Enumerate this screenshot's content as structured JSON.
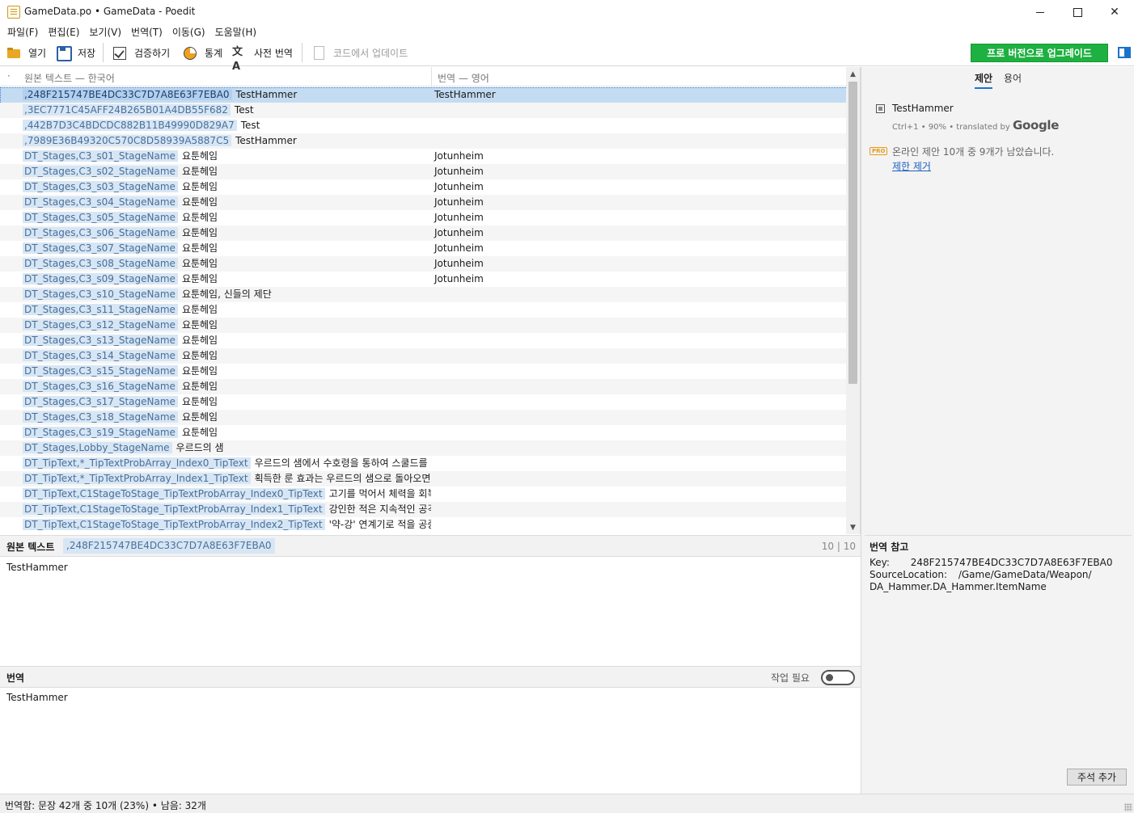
{
  "window": {
    "title": "GameData.po • GameData - Poedit"
  },
  "menu": [
    "파일(F)",
    "편집(E)",
    "보기(V)",
    "번역(T)",
    "이동(G)",
    "도움말(H)"
  ],
  "toolbar": {
    "open": "열기",
    "save": "저장",
    "validate": "검증하기",
    "stats": "통계",
    "pretranslate": "사전 번역",
    "update_from_code": "코드에서 업데이트",
    "upgrade": "프로 버전으로 업그레이드"
  },
  "list": {
    "header_marker": "·",
    "source_header": "원본 텍스트 — 한국어",
    "translation_header": "번역 — 영어",
    "rows": [
      {
        "ctx": ",248F215747BE4DC33C7D7A8E63F7EBA0",
        "src": "TestHammer",
        "trn": "TestHammer",
        "selected": true
      },
      {
        "ctx": ",3EC7771C45AFF24B265B01A4DB55F682",
        "src": "Test",
        "trn": ""
      },
      {
        "ctx": ",442B7D3C4BDCDC882B11B49990D829A7",
        "src": "Test",
        "trn": ""
      },
      {
        "ctx": ",7989E36B49320C570C8D58939A5887C5",
        "src": "TestHammer",
        "trn": ""
      },
      {
        "ctx": "DT_Stages,C3_s01_StageName",
        "src": "요툰헤임",
        "trn": "Jotunheim"
      },
      {
        "ctx": "DT_Stages,C3_s02_StageName",
        "src": "요툰헤임",
        "trn": "Jotunheim"
      },
      {
        "ctx": "DT_Stages,C3_s03_StageName",
        "src": "요툰헤임",
        "trn": "Jotunheim"
      },
      {
        "ctx": "DT_Stages,C3_s04_StageName",
        "src": "요툰헤임",
        "trn": "Jotunheim"
      },
      {
        "ctx": "DT_Stages,C3_s05_StageName",
        "src": "요툰헤임",
        "trn": "Jotunheim"
      },
      {
        "ctx": "DT_Stages,C3_s06_StageName",
        "src": "요툰헤임",
        "trn": "Jotunheim"
      },
      {
        "ctx": "DT_Stages,C3_s07_StageName",
        "src": "요툰헤임",
        "trn": "Jotunheim"
      },
      {
        "ctx": "DT_Stages,C3_s08_StageName",
        "src": "요툰헤임",
        "trn": "Jotunheim"
      },
      {
        "ctx": "DT_Stages,C3_s09_StageName",
        "src": "요툰헤임",
        "trn": "Jotunheim"
      },
      {
        "ctx": "DT_Stages,C3_s10_StageName",
        "src": "요툰헤임, 신들의 제단",
        "trn": ""
      },
      {
        "ctx": "DT_Stages,C3_s11_StageName",
        "src": "요툰헤임",
        "trn": ""
      },
      {
        "ctx": "DT_Stages,C3_s12_StageName",
        "src": "요툰헤임",
        "trn": ""
      },
      {
        "ctx": "DT_Stages,C3_s13_StageName",
        "src": "요툰헤임",
        "trn": ""
      },
      {
        "ctx": "DT_Stages,C3_s14_StageName",
        "src": "요툰헤임",
        "trn": ""
      },
      {
        "ctx": "DT_Stages,C3_s15_StageName",
        "src": "요툰헤임",
        "trn": ""
      },
      {
        "ctx": "DT_Stages,C3_s16_StageName",
        "src": "요툰헤임",
        "trn": ""
      },
      {
        "ctx": "DT_Stages,C3_s17_StageName",
        "src": "요툰헤임",
        "trn": ""
      },
      {
        "ctx": "DT_Stages,C3_s18_StageName",
        "src": "요툰헤임",
        "trn": ""
      },
      {
        "ctx": "DT_Stages,C3_s19_StageName",
        "src": "요툰헤임",
        "trn": ""
      },
      {
        "ctx": "DT_Stages,Lobby_StageName",
        "src": "우르드의 샘",
        "trn": ""
      },
      {
        "ctx": "DT_TipText,*_TipTextProbArray_Index0_TipText",
        "src": "우르드의 샘에서 수호령을 통하여 스쿨드를 ...",
        "trn": ""
      },
      {
        "ctx": "DT_TipText,*_TipTextProbArray_Index1_TipText",
        "src": "획득한 룬 효과는 우르드의 샘으로 돌아오면...",
        "trn": ""
      },
      {
        "ctx": "DT_TipText,C1StageToStage_TipTextProbArray_Index0_TipText",
        "src": "고기를 먹어서 체력을 회복...",
        "trn": ""
      },
      {
        "ctx": "DT_TipText,C1StageToStage_TipTextProbArray_Index1_TipText",
        "src": "강인한 적은 지속적인 공격...",
        "trn": ""
      },
      {
        "ctx": "DT_TipText,C1StageToStage_TipTextProbArray_Index2_TipText",
        "src": "'약-강' 연계기로 적을 공중에...",
        "trn": ""
      }
    ]
  },
  "source_editor": {
    "label": "원본 텍스트",
    "context": ",248F215747BE4DC33C7D7A8E63F7EBA0",
    "counter": "10 | 10",
    "text": "TestHammer"
  },
  "translation_editor": {
    "label": "번역",
    "fuzzy_label": "작업 필요",
    "fuzzy_on": false,
    "text": "TestHammer"
  },
  "sidebar": {
    "tab_suggestions": "제안",
    "tab_terms": "용어",
    "suggestion_text": "TestHammer",
    "suggestion_meta": "Ctrl+1 • 90% • translated by",
    "suggestion_provider": "Google",
    "pro_badge": "PRO",
    "pro_notice": "온라인 제안 10개 중 9개가 남았습니다.",
    "pro_link": "제한 제거",
    "notes_title": "번역 참고",
    "note_key_label": "Key:",
    "note_key_value": "248F215747BE4DC33C7D7A8E63F7EBA0",
    "note_src_label": "SourceLocation:",
    "note_src_value": "/Game/GameData/Weapon/",
    "note_src_value2": "DA_Hammer.DA_Hammer.ItemName",
    "add_comment": "주석 추가"
  },
  "status": {
    "text": "번역함: 문장 42개 중 10개 (23%)  •  남음: 32개"
  },
  "colors": {
    "accent": "#1a73c8",
    "upgrade": "#1eb040",
    "selection": "#c4dcf2"
  }
}
